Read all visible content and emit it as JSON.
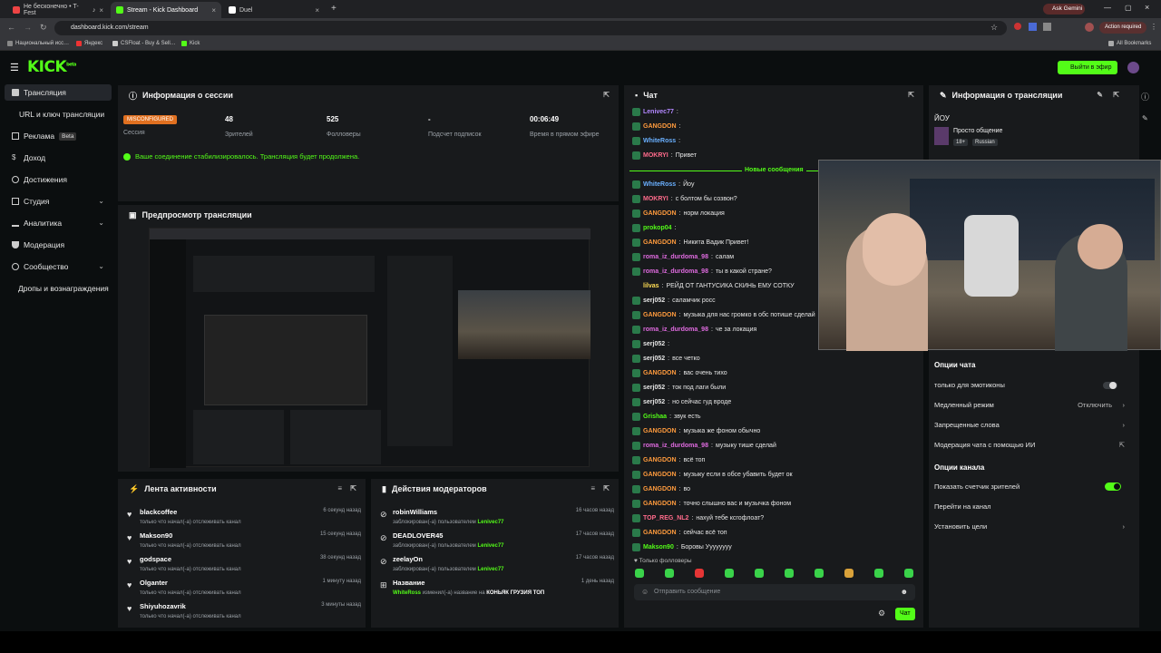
{
  "browser": {
    "tabs": [
      {
        "label": "Не бесконечно • T-Fest",
        "fav": "#e44"
      },
      {
        "label": "Stream - Kick Dashboard",
        "fav": "#53fc18"
      },
      {
        "label": "Duel",
        "fav": "#fff"
      }
    ],
    "url": "dashboard.kick.com/stream",
    "gemini": "Ask Gemini",
    "action": "Action required",
    "bookmarks": [
      "Национальный исс…",
      "Яндекс",
      "CSFloat - Buy & Sell…",
      "Kick"
    ],
    "all_bookmarks": "All Bookmarks"
  },
  "header": {
    "logo": "KICK",
    "logo_sup": "beta",
    "end_stream": "Выйти в эфир"
  },
  "sidebar": {
    "items": [
      {
        "label": "Трансляция",
        "icon": "video-icon"
      },
      {
        "label": "URL и ключ трансляции"
      },
      {
        "label": "Реклама",
        "badge": "Beta",
        "icon": "ad-icon"
      },
      {
        "label": "Доход",
        "icon": "dollar-icon"
      },
      {
        "label": "Достижения",
        "icon": "trophy-icon"
      },
      {
        "label": "Студия",
        "icon": "studio-icon"
      },
      {
        "label": "Аналитика",
        "icon": "chart-icon"
      },
      {
        "label": "Модерация",
        "icon": "shield-icon"
      },
      {
        "label": "Сообщество",
        "icon": "community-icon"
      },
      {
        "label": "Дропы и вознаграждения"
      }
    ]
  },
  "session": {
    "title": "Информация о сессии",
    "status_badge": "MISCONFIGURED",
    "status_label": "Сессия",
    "stats": [
      {
        "value": "48",
        "label": "Зрителей"
      },
      {
        "value": "525",
        "label": "Фолловеры"
      },
      {
        "value": "-",
        "label": "Подсчет подписок"
      },
      {
        "value": "00:06:49",
        "label": "Время в прямом эфире"
      }
    ],
    "notice": "Ваше соединение стабилизировалось. Трансляция будет продолжена."
  },
  "preview": {
    "title": "Предпросмотр трансляции"
  },
  "activity": {
    "title": "Лента активности",
    "items": [
      {
        "name": "blackcoffee",
        "desc": "только что начал(-а) отслеживать канал",
        "time": "6 секунд назад"
      },
      {
        "name": "Makson90",
        "desc": "только что начал(-а) отслеживать канал",
        "time": "15 секунд назад"
      },
      {
        "name": "godspace",
        "desc": "только что начал(-а) отслеживать канал",
        "time": "38 секунд назад"
      },
      {
        "name": "Olganter",
        "desc": "только что начал(-а) отслеживать канал",
        "time": "1 минуту назад"
      },
      {
        "name": "Shiyuhozavrik",
        "desc": "только что начал(-а) отслеживать канал",
        "time": "3 минуты назад"
      }
    ]
  },
  "modactions": {
    "title": "Действия модераторов",
    "items": [
      {
        "name": "robinWilliams",
        "desc": "заблокирован(-а) пользователем",
        "who": "Lenivec77",
        "time": "16 часов назад"
      },
      {
        "name": "DEADLOVER45",
        "desc": "заблокирован(-а) пользователем",
        "who": "Lenivec77",
        "time": "17 часов назад"
      },
      {
        "name": "zeelayOn",
        "desc": "заблокирован(-а) пользователем",
        "who": "Lenivec77",
        "time": "17 часов назад"
      },
      {
        "name": "Название",
        "desc": "изменил(-а) название на",
        "who": "WhiteRoss",
        "extra": "КОНЬЯК ГРУЗИЯ ТОП",
        "time": "1 день назад"
      }
    ]
  },
  "chat": {
    "title": "Чат",
    "new_messages": "Новые сообщения",
    "messages": [
      {
        "user": "Lenivec77",
        "text": "",
        "color": "#b388ff"
      },
      {
        "user": "GANGDON",
        "text": "",
        "color": "#ff9b3d"
      },
      {
        "user": "WhiteRoss",
        "text": "",
        "color": "#6ab0ff"
      },
      {
        "user": "MOKRYI",
        "text": "Привет",
        "color": "#ff6b8b"
      },
      {
        "user": "WhiteRoss",
        "text": "Йоу",
        "color": "#6ab0ff"
      },
      {
        "user": "MOKRYI",
        "text": "с болтом бы созвон?",
        "color": "#ff6b8b"
      },
      {
        "user": "GANGDON",
        "text": "норм локация",
        "color": "#ff9b3d"
      },
      {
        "user": "prokop04",
        "text": "",
        "color": "#53fc18"
      },
      {
        "user": "GANGDON",
        "text": "Никита Вадик Привет!",
        "color": "#ff9b3d"
      },
      {
        "user": "roma_iz_durdoma_98",
        "text": "салам",
        "color": "#e06be0"
      },
      {
        "user": "roma_iz_durdoma_98",
        "text": "ты в какой стране?",
        "color": "#e06be0"
      },
      {
        "user": "lilvas",
        "text": "РЕЙД ОТ ГАНТУСИКА СКИНЬ ЕМУ СОТКУ",
        "color": "#ffdd55"
      },
      {
        "user": "serj052",
        "text": "саламчик росс",
        "color": "#e6e6e6"
      },
      {
        "user": "GANGDON",
        "text": "музыка для нас громко в обс потише сделай",
        "color": "#ff9b3d"
      },
      {
        "user": "roma_iz_durdoma_98",
        "text": "че за локация",
        "color": "#e06be0"
      },
      {
        "user": "serj052",
        "text": "",
        "color": "#e6e6e6"
      },
      {
        "user": "serj052",
        "text": "все четко",
        "color": "#e6e6e6"
      },
      {
        "user": "GANGDON",
        "text": "вас очень тихо",
        "color": "#ff9b3d"
      },
      {
        "user": "serj052",
        "text": "ток под лаги были",
        "color": "#e6e6e6"
      },
      {
        "user": "serj052",
        "text": "но сейчас гуд вроде",
        "color": "#e6e6e6"
      },
      {
        "user": "Grishaa",
        "text": "звук есть",
        "color": "#53fc18"
      },
      {
        "user": "GANGDON",
        "text": "музыка же фоном обычно",
        "color": "#ff9b3d"
      },
      {
        "user": "roma_iz_durdoma_98",
        "text": "музыку тише сделай",
        "color": "#e06be0"
      },
      {
        "user": "GANGDON",
        "text": "всё топ",
        "color": "#ff9b3d"
      },
      {
        "user": "GANGDON",
        "text": "музыку если в обсе убавить будет ок",
        "color": "#ff9b3d"
      },
      {
        "user": "GANGDON",
        "text": "во",
        "color": "#ff9b3d"
      },
      {
        "user": "GANGDON",
        "text": "точно слышно вас и музычка фоном",
        "color": "#ff9b3d"
      },
      {
        "user": "TOP_REG_NL2",
        "text": "нахуй тебе ксгофлоат?",
        "color": "#ff6b8b"
      },
      {
        "user": "GANGDON",
        "text": "сейчас всё топ",
        "color": "#ff9b3d"
      },
      {
        "user": "Makson90",
        "text": "Боровы Уууууууу",
        "color": "#53fc18"
      }
    ],
    "followers_only": "Только фолловеры",
    "input_placeholder": "Отправить сообщение",
    "send": "Чат"
  },
  "streaminfo": {
    "title": "Информация о трансляции",
    "stream_title": "ЙОУ",
    "category": "Просто общение",
    "age": "18+",
    "language": "Russian"
  },
  "chat_options": {
    "title": "Опции чата",
    "items": [
      {
        "label": "только для эмотиконы",
        "type": "toggle",
        "on": false
      },
      {
        "label": "Медленный режим",
        "value": "Отключить",
        "type": "arrow"
      },
      {
        "label": "Запрещенные слова",
        "type": "arrow"
      },
      {
        "label": "Модерация чата с помощью ИИ",
        "type": "ext"
      }
    ]
  },
  "channel_options": {
    "title": "Опции канала",
    "items": [
      {
        "label": "Показать счетчик зрителей",
        "type": "toggle",
        "on": true
      },
      {
        "label": "Перейти на канал",
        "type": "none"
      },
      {
        "label": "Установить цели",
        "type": "arrow"
      }
    ]
  }
}
